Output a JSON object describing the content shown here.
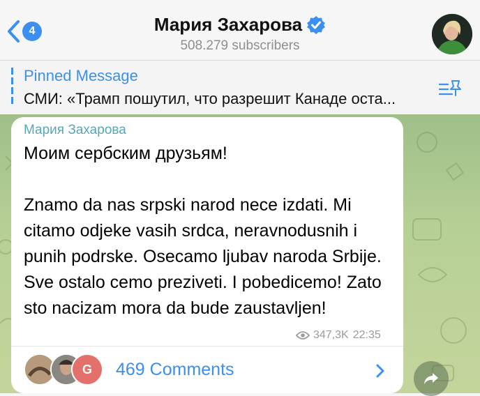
{
  "header": {
    "back_count": "4",
    "channel_name": "Мария Захарова",
    "subscribers": "508.279 subscribers"
  },
  "pinned": {
    "label": "Pinned Message",
    "text": "СМИ: «Трамп пошутил, что разрешит Канаде оста..."
  },
  "message": {
    "sender": "Мария Захарова",
    "text": "Моим сербским друзьям!\n\nZnamo da nas srpski narod nece izdati. Mi citamo odjeke vasih srdca, neravnodusnih i punih podrske. Osecamo ljubav naroda Srbije. Sve ostalo cemo preziveti. I pobedicemo! Zato sto nacizam mora da bude zaustavljen!",
    "views": "347,3K",
    "time": "22:35"
  },
  "comments": {
    "label": "469 Comments",
    "avatar_letter": "G"
  },
  "colors": {
    "accent": "#3a8ff0",
    "sender": "#5aa5b8",
    "chat_bg": "#b6cf95"
  },
  "icons": {
    "back": "chevron-left-icon",
    "verified": "verified-badge-icon",
    "pin_list": "pinned-list-icon",
    "views": "eye-icon",
    "comments_arrow": "chevron-right-icon",
    "share": "share-arrow-icon"
  }
}
